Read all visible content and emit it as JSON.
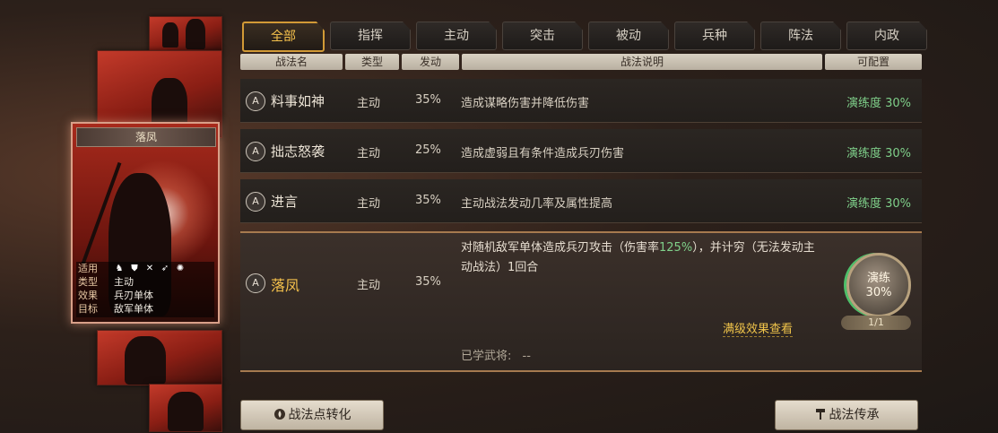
{
  "tabs": [
    "全部",
    "指挥",
    "主动",
    "突击",
    "被动",
    "兵种",
    "阵法",
    "内政"
  ],
  "active_tab": "全部",
  "columns": {
    "name": "战法名",
    "type": "类型",
    "rate": "发动",
    "desc": "战法说明",
    "config": "可配置"
  },
  "skills": [
    {
      "grade": "A",
      "name": "料事如神",
      "type": "主动",
      "rate": "35%",
      "desc": "造成谋略伤害并降低伤害",
      "proficiency": "演练度 30%"
    },
    {
      "grade": "A",
      "name": "拙志怒袭",
      "type": "主动",
      "rate": "25%",
      "desc": "造成虚弱且有条件造成兵刃伤害",
      "proficiency": "演练度 30%"
    },
    {
      "grade": "A",
      "name": "进言",
      "type": "主动",
      "rate": "35%",
      "desc": "主动战法发动几率及属性提高",
      "proficiency": "演练度 30%"
    }
  ],
  "selected": {
    "grade": "A",
    "name": "落凤",
    "type": "主动",
    "rate": "35%",
    "desc_part1": "对随机敌军单体造成兵刃攻击（伤害率",
    "desc_highlight": "125%",
    "desc_part2": "），并计穷（无法发动主动战法）1回合",
    "full_effect": "满级效果查看",
    "learned_label": "已学武将:",
    "learned_value": "--",
    "train_label": "演练",
    "train_percent": "30%",
    "train_count": "1/1"
  },
  "card": {
    "title": "落凤",
    "labels": {
      "apply": "适用",
      "type": "类型",
      "effect": "效果",
      "target": "目标"
    },
    "type": "主动",
    "effect": "兵刃单体",
    "target": "敌军单体"
  },
  "buttons": {
    "convert": "战法点转化",
    "inherit": "战法传承"
  },
  "colors": {
    "accent": "#f5c14c",
    "proficiency": "#7fd08a",
    "card_red": "#a82a1c"
  }
}
